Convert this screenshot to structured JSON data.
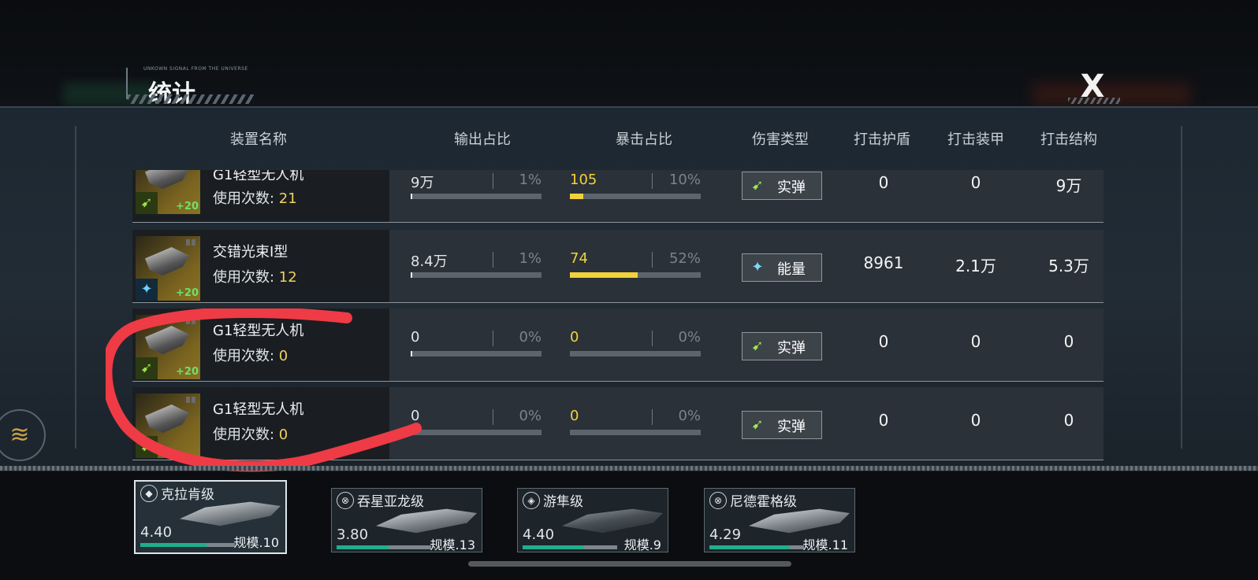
{
  "header": {
    "tag": "UNKOWN SIGNAL FROM THE UNIVERSE",
    "title": "统计",
    "close_label": "X"
  },
  "columns": [
    "装置名称",
    "输出占比",
    "暴击占比",
    "伤害类型",
    "打击护盾",
    "打击装甲",
    "打击结构"
  ],
  "uses_label": "使用次数: ",
  "rows": [
    {
      "name": "G1轻型无人机",
      "uses": "21",
      "level": "+20",
      "output": "9万",
      "output_pct": "1%",
      "output_fill": 0.01,
      "crit": "105",
      "crit_pct": "10%",
      "crit_fill": 0.1,
      "damage_type": "实弹",
      "damage_icon": "kinetic-icon",
      "shield": "0",
      "armor": "0",
      "structure": "9万"
    },
    {
      "name": "交错光束I型",
      "uses": "12",
      "level": "+20",
      "output": "8.4万",
      "output_pct": "1%",
      "output_fill": 0.01,
      "crit": "74",
      "crit_pct": "52%",
      "crit_fill": 0.52,
      "damage_type": "能量",
      "damage_icon": "energy-icon",
      "shield": "8961",
      "armor": "2.1万",
      "structure": "5.3万"
    },
    {
      "name": "G1轻型无人机",
      "uses": "0",
      "level": "+20",
      "output": "0",
      "output_pct": "0%",
      "output_fill": 0,
      "crit": "0",
      "crit_pct": "0%",
      "crit_fill": 0,
      "damage_type": "实弹",
      "damage_icon": "kinetic-icon",
      "shield": "0",
      "armor": "0",
      "structure": "0"
    },
    {
      "name": "G1轻型无人机",
      "uses": "0",
      "level": "",
      "output": "0",
      "output_pct": "0%",
      "output_fill": 0,
      "crit": "0",
      "crit_pct": "0%",
      "crit_fill": 0,
      "damage_type": "实弹",
      "damage_icon": "kinetic-icon",
      "shield": "0",
      "armor": "0",
      "structure": "0"
    }
  ],
  "ships": [
    {
      "class_name": "克拉肯级",
      "power": "4.40",
      "scale": "规模.10",
      "power_fill": 0.7,
      "active": true
    },
    {
      "class_name": "吞星亚龙级",
      "power": "3.80",
      "scale": "规模.13",
      "power_fill": 0.55,
      "active": false
    },
    {
      "class_name": "游隼级",
      "power": "4.40",
      "scale": "规模.9",
      "power_fill": 0.65,
      "active": false
    },
    {
      "class_name": "尼德霍格级",
      "power": "4.29",
      "scale": "规模.11",
      "power_fill": 0.85,
      "active": false
    }
  ],
  "colors": {
    "accent_yellow": "#f2d23a",
    "annotation_red": "#ee3b45",
    "power_bar": "#1fae8e"
  }
}
